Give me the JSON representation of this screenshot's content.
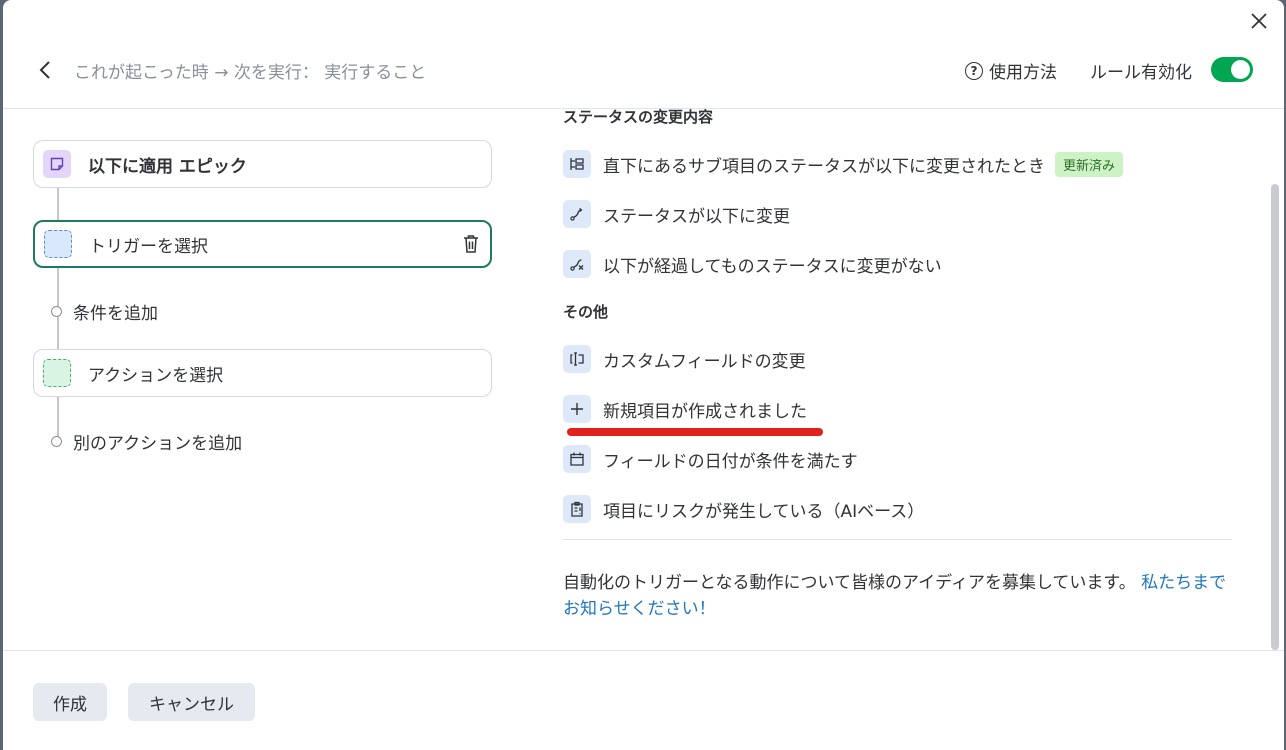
{
  "header": {
    "breadcrumb": "これが起こった時 → 次を実行： 実行すること",
    "howto_label": "使用方法",
    "rule_enable_label": "ルール有効化",
    "rule_enabled": true
  },
  "builder": {
    "apply_card": {
      "prefix": "以下に適用",
      "target": "エピック"
    },
    "trigger_card": {
      "label": "トリガーを選択"
    },
    "add_condition": "条件を追加",
    "action_card": {
      "label": "アクションを選択"
    },
    "add_action": "別のアクションを追加"
  },
  "triggers": {
    "status_section_title": "ステータスの変更内容",
    "status_items": [
      {
        "icon": "subitems-icon",
        "label": "直下にあるサブ項目のステータスが以下に変更されたとき",
        "badge": "更新済み"
      },
      {
        "icon": "status-change-icon",
        "label": "ステータスが以下に変更"
      },
      {
        "icon": "no-change-icon",
        "label": "以下が経過してものステータスに変更がない"
      }
    ],
    "other_section_title": "その他",
    "other_items": [
      {
        "icon": "custom-field-icon",
        "label": "カスタムフィールドの変更"
      },
      {
        "icon": "plus-icon",
        "label": "新規項目が作成されました"
      },
      {
        "icon": "calendar-icon",
        "label": "フィールドの日付が条件を満たす"
      },
      {
        "icon": "risk-clipboard-icon",
        "label": "項目にリスクが発生している（AIベース）"
      }
    ],
    "feedback_text": "自動化のトリガーとなる動作について皆様のアイディアを募集しています。",
    "feedback_link": "私たちまでお知らせください！"
  },
  "footer": {
    "create_label": "作成",
    "cancel_label": "キャンセル"
  },
  "colors": {
    "toggle_on": "#00a651",
    "highlight_underline": "#e0211c",
    "link": "#1f76c2",
    "badge_bg": "#cdf2c5"
  }
}
